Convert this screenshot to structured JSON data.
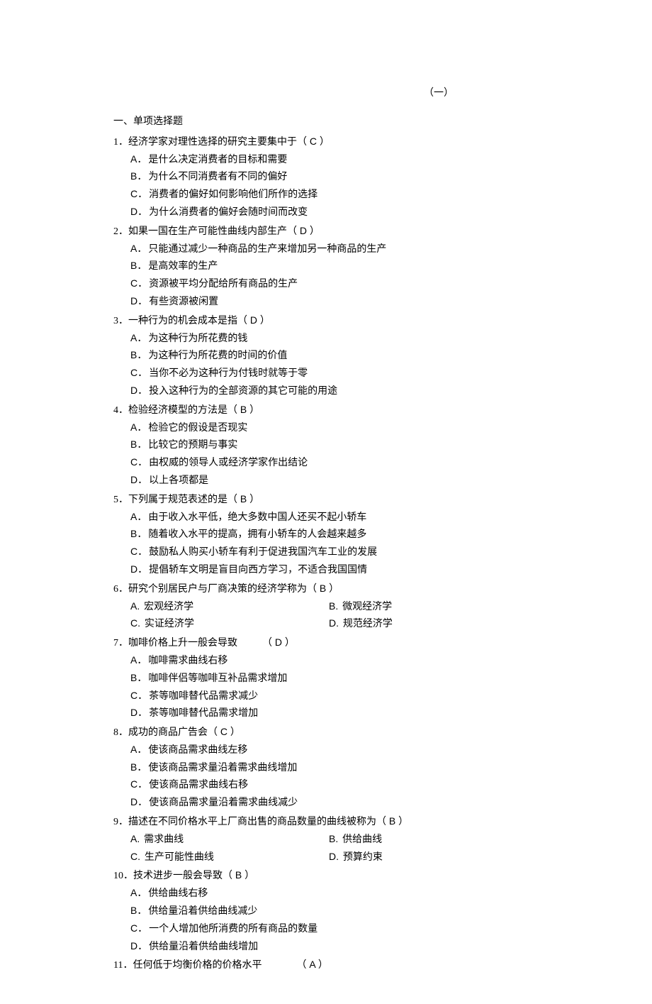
{
  "chapter_number": "（一）",
  "section_title": "一、单项选择题",
  "questions": [
    {
      "num": "1．",
      "stem": "经济学家对理性选择的研究主要集中于（",
      "answer": " C ",
      "close": "）",
      "layout": "vertical",
      "options": [
        {
          "letter": "A．",
          "text": "是什么决定消费者的目标和需要"
        },
        {
          "letter": "B．",
          "text": "为什么不同消费者有不同的偏好"
        },
        {
          "letter": "C．",
          "text": "消费者的偏好如何影响他们所作的选择"
        },
        {
          "letter": "D．",
          "text": "为什么消费者的偏好会随时间而改变"
        }
      ]
    },
    {
      "num": "2．",
      "stem": "如果一国在生产可能性曲线内部生产（",
      "answer": " D ",
      "close": "）",
      "layout": "vertical",
      "options": [
        {
          "letter": "A．",
          "text": "只能通过减少一种商品的生产来增加另一种商品的生产"
        },
        {
          "letter": "B．",
          "text": "是高效率的生产"
        },
        {
          "letter": "C．",
          "text": "资源被平均分配给所有商品的生产"
        },
        {
          "letter": "D．",
          "text": "有些资源被闲置"
        }
      ]
    },
    {
      "num": "3．",
      "stem": "一种行为的机会成本是指（",
      "answer": " D ",
      "close": "）",
      "layout": "vertical",
      "options": [
        {
          "letter": "A．",
          "text": "为这种行为所花费的钱"
        },
        {
          "letter": "B．",
          "text": "为这种行为所花费的时间的价值"
        },
        {
          "letter": "C．",
          "text": "当你不必为这种行为付钱时就等于零"
        },
        {
          "letter": "D．",
          "text": "投入这种行为的全部资源的其它可能的用途"
        }
      ]
    },
    {
      "num": "4．",
      "stem": "检验经济模型的方法是（",
      "answer": " B ",
      "close": "）",
      "layout": "vertical",
      "options": [
        {
          "letter": "A．",
          "text": "检验它的假设是否现实"
        },
        {
          "letter": "B．",
          "text": "比较它的预期与事实"
        },
        {
          "letter": "C．",
          "text": "由权威的领导人或经济学家作出结论"
        },
        {
          "letter": "D．",
          "text": "以上各项都是"
        }
      ]
    },
    {
      "num": "5．",
      "stem": "下列属于规范表述的是（",
      "answer": " B ",
      "close": "）",
      "layout": "vertical",
      "options": [
        {
          "letter": "A．",
          "text": "由于收入水平低，绝大多数中国人还买不起小轿车"
        },
        {
          "letter": "B．",
          "text": "随着收入水平的提高，拥有小轿车的人会越来越多"
        },
        {
          "letter": "C．",
          "text": "鼓励私人购买小轿车有利于促进我国汽车工业的发展"
        },
        {
          "letter": "D．",
          "text": "提倡轿车文明是盲目向西方学习，不适合我国国情"
        }
      ]
    },
    {
      "num": "6．",
      "stem": "研究个别居民户与厂商决策的经济学称为（",
      "answer": " B ",
      "close": "）",
      "layout": "two-col",
      "options": [
        {
          "letter": "A. ",
          "text": "宏观经济学"
        },
        {
          "letter": "B. ",
          "text": "微观经济学"
        },
        {
          "letter": "C. ",
          "text": "实证经济学"
        },
        {
          "letter": "D. ",
          "text": "规范经济学"
        }
      ]
    },
    {
      "num": "7．",
      "stem": "咖啡价格上升一般会导致　　　（",
      "answer": " D ",
      "close": "）",
      "layout": "vertical",
      "options": [
        {
          "letter": "A．",
          "text": "咖啡需求曲线右移"
        },
        {
          "letter": "B．",
          "text": "咖啡伴侣等咖啡互补品需求增加"
        },
        {
          "letter": "C．",
          "text": "茶等咖啡替代品需求减少"
        },
        {
          "letter": "D．",
          "text": "茶等咖啡替代品需求增加"
        }
      ]
    },
    {
      "num": "8．",
      "stem": "成功的商品广告会（",
      "answer": " C ",
      "close": "）",
      "layout": "vertical",
      "options": [
        {
          "letter": "A．",
          "text": "使该商品需求曲线左移"
        },
        {
          "letter": "B．",
          "text": "使该商品需求量沿着需求曲线增加"
        },
        {
          "letter": "C．",
          "text": "使该商品需求曲线右移"
        },
        {
          "letter": "D．",
          "text": "使该商品需求量沿着需求曲线减少"
        }
      ]
    },
    {
      "num": "9．",
      "stem": "描述在不同价格水平上厂商出售的商品数量的曲线被称为（",
      "answer": " B ",
      "close": "）",
      "layout": "two-col",
      "options": [
        {
          "letter": "A. ",
          "text": "需求曲线"
        },
        {
          "letter": "B. ",
          "text": "供给曲线"
        },
        {
          "letter": "C. ",
          "text": "生产可能性曲线"
        },
        {
          "letter": "D. ",
          "text": "预算约束"
        }
      ]
    },
    {
      "num": "10．",
      "stem": "技术进步一般会导致（",
      "answer": " B ",
      "close": "）",
      "layout": "vertical",
      "options": [
        {
          "letter": "A．",
          "text": "供给曲线右移"
        },
        {
          "letter": "B．",
          "text": "供给量沿着供给曲线减少"
        },
        {
          "letter": "C．",
          "text": "一个人增加他所消费的所有商品的数量"
        },
        {
          "letter": "D．",
          "text": "供给量沿着供给曲线增加"
        }
      ]
    },
    {
      "num": "11．",
      "stem": "任何低于均衡价格的价格水平　　　　（",
      "answer": " A ",
      "close": "）",
      "layout": "none",
      "options": []
    }
  ]
}
